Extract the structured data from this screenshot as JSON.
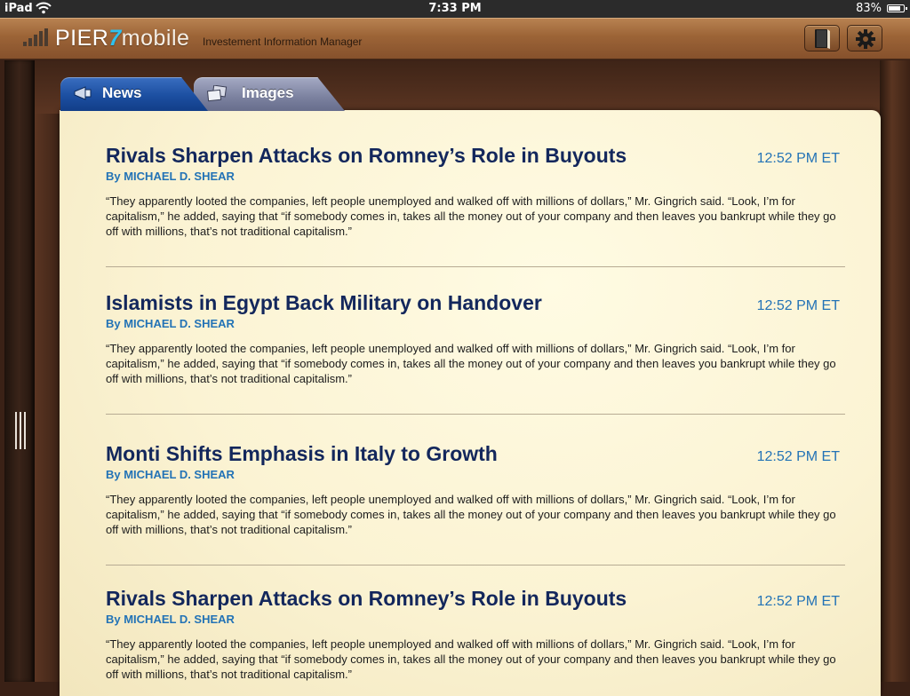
{
  "statusbar": {
    "device": "iPad",
    "time": "7:33 PM",
    "battery_percent": "83%",
    "battery_level": 0.83
  },
  "header": {
    "brand_part1": "PIER",
    "brand_part2": "7",
    "brand_part3": "mobile",
    "tagline": "Investement Information Manager",
    "icons": [
      "signal-bars-icon",
      "book-icon",
      "gear-icon"
    ]
  },
  "tabs": [
    {
      "label": "News",
      "active": true,
      "icon": "megaphone-icon"
    },
    {
      "label": "Images",
      "active": false,
      "icon": "images-icon"
    }
  ],
  "colors": {
    "title": "#13275c",
    "accent_blue": "#2373b6",
    "active_tab": "#1c4fa1",
    "inactive_tab": "#7b819f",
    "brand_seven": "#2ec1ee"
  },
  "news": [
    {
      "title": "Rivals Sharpen Attacks on Romney’s Role in Buyouts",
      "author": "By MICHAEL D. SHEAR",
      "time": "12:52 PM ET",
      "body": "“They apparently looted the companies, left people unemployed and walked off with millions of dollars,” Mr. Gingrich said. “Look, I’m for capitalism,” he added, saying that “if somebody comes in, takes all the money out of your company and then leaves you bankrupt while they go off with millions, that’s not traditional capitalism.”"
    },
    {
      "title": "Islamists in Egypt Back Military on Handover",
      "author": "By MICHAEL D. SHEAR",
      "time": "12:52 PM ET",
      "body": "“They apparently looted the companies, left people unemployed and walked off with millions of dollars,” Mr. Gingrich said. “Look, I’m for capitalism,” he added, saying that “if somebody comes in, takes all the money out of your company and then leaves you bankrupt while they go off with millions, that’s not traditional capitalism.”"
    },
    {
      "title": "Monti Shifts Emphasis in Italy to Growth",
      "author": "By MICHAEL D. SHEAR",
      "time": "12:52 PM ET",
      "body": "“They apparently looted the companies, left people unemployed and walked off with millions of dollars,” Mr. Gingrich said. “Look, I’m for capitalism,” he added, saying that “if somebody comes in, takes all the money out of your company and then leaves you bankrupt while they go off with millions, that’s not traditional capitalism.”"
    },
    {
      "title": "Rivals Sharpen Attacks on Romney’s Role in Buyouts",
      "author": "By MICHAEL D. SHEAR",
      "time": "12:52 PM ET",
      "body": "“They apparently looted the companies, left people unemployed and walked off with millions of dollars,” Mr. Gingrich said. “Look, I’m for capitalism,” he added, saying that “if somebody comes in, takes all the money out of your company and then leaves you bankrupt while they go off with millions, that’s not traditional capitalism.”"
    }
  ]
}
